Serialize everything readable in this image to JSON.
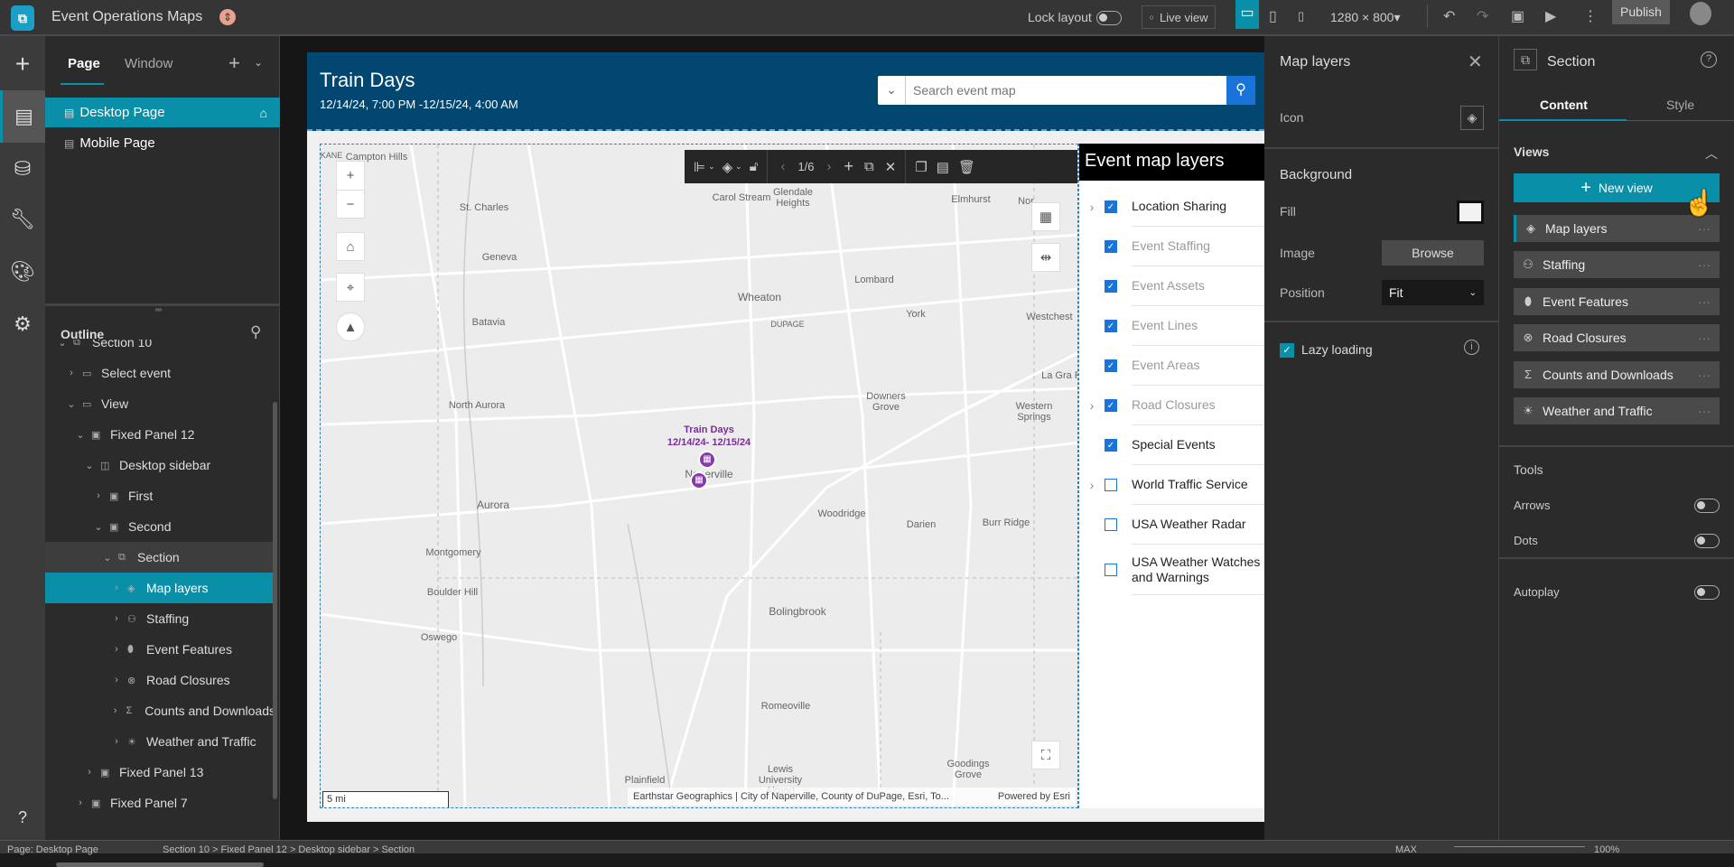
{
  "app": {
    "title": "Event Operations Maps",
    "status_color": "#e8a08f"
  },
  "topbar": {
    "lock_layout": "Lock layout",
    "lock_layout_on": false,
    "live_view": "Live view",
    "resolution": "1280 × 800",
    "publish": "Publish",
    "accent": "#0a8fa8"
  },
  "left": {
    "tabs": [
      "Page",
      "Window"
    ],
    "active_tab": "Page",
    "pages": [
      {
        "label": "Desktop Page",
        "home": true,
        "selected": true
      },
      {
        "label": "Mobile Page"
      }
    ],
    "outline_title": "Outline",
    "outline": [
      {
        "label": "Section 10",
        "depth": 0,
        "exp": "v",
        "icon": "section"
      },
      {
        "label": "Select event",
        "depth": 1,
        "exp": ">",
        "icon": "view"
      },
      {
        "label": "View",
        "depth": 1,
        "exp": "v",
        "icon": "view"
      },
      {
        "label": "Fixed Panel 12",
        "depth": 2,
        "exp": "v",
        "icon": "panel"
      },
      {
        "label": "Desktop sidebar",
        "depth": 3,
        "exp": "v",
        "icon": "sidebar"
      },
      {
        "label": "First",
        "depth": 4,
        "exp": ">",
        "icon": "panel"
      },
      {
        "label": "Second",
        "depth": 4,
        "exp": "v",
        "icon": "panel"
      },
      {
        "label": "Section",
        "depth": 5,
        "exp": "v",
        "icon": "section",
        "hover": true
      },
      {
        "label": "Map layers",
        "depth": 6,
        "exp": ">",
        "icon": "layers",
        "selected": true
      },
      {
        "label": "Staffing",
        "depth": 6,
        "exp": ">",
        "icon": "user"
      },
      {
        "label": "Event Features",
        "depth": 6,
        "exp": ">",
        "icon": "pin"
      },
      {
        "label": "Road Closures",
        "depth": 6,
        "exp": ">",
        "icon": "x-circle"
      },
      {
        "label": "Counts and Downloads",
        "depth": 6,
        "exp": ">",
        "icon": "sigma"
      },
      {
        "label": "Weather and Traffic",
        "depth": 6,
        "exp": ">",
        "icon": "weather"
      },
      {
        "label": "Fixed Panel 13",
        "depth": 3,
        "exp": ">",
        "icon": "panel"
      },
      {
        "label": "Fixed Panel 7",
        "depth": 2,
        "exp": ">",
        "icon": "panel"
      }
    ]
  },
  "page": {
    "title": "Train Days",
    "subtitle": "12/14/24, 7:00 PM -12/15/24, 4:00 AM",
    "header_color": "#02476f",
    "search_placeholder": "Search event map",
    "toolbar_pager": "1/6",
    "map": {
      "places": [
        "Campton Hills",
        "St. Charles",
        "Carol Stream",
        "Glendale Heights",
        "Elmhurst",
        "Geneva",
        "Wheaton",
        "Lombard",
        "DUPAGE",
        "York",
        "Batavia",
        "Westchest",
        "La Gra Par",
        "North Aurora",
        "Downers Grove",
        "Western Springs",
        "Naperville",
        "Aurora",
        "Woodridge",
        "Darien",
        "Burr Ridge",
        "Montgomery",
        "Boulder Hill",
        "Oswego",
        "Bolingbrook",
        "Romeoville",
        "Plainfield",
        "Lewis University Airport",
        "Goodings Grove",
        "Nor",
        "KANE"
      ],
      "event_label": "Train Days",
      "event_dates": "12/14/24- 12/15/24",
      "scale": "5 mi",
      "attribution": "Earthstar Geographics | City of Naperville, County of DuPage, Esri, To...",
      "powered": "Powered by Esri"
    },
    "layers_title": "Event map layers",
    "layers": [
      {
        "label": "Location Sharing",
        "checked": true,
        "expandable": true,
        "dim": false
      },
      {
        "label": "Event Staffing",
        "checked": true,
        "dim": true
      },
      {
        "label": "Event Assets",
        "checked": true,
        "dim": true
      },
      {
        "label": "Event Lines",
        "checked": true,
        "dim": true
      },
      {
        "label": "Event Areas",
        "checked": true,
        "dim": true
      },
      {
        "label": "Road Closures",
        "checked": true,
        "expandable": true,
        "dim": true
      },
      {
        "label": "Special Events",
        "checked": true,
        "dim": false
      },
      {
        "label": "World Traffic Service",
        "checked": false,
        "expandable": true,
        "dim": false
      },
      {
        "label": "USA Weather Radar",
        "checked": false,
        "dim": false
      },
      {
        "label": "USA Weather Watches and Warnings",
        "checked": false,
        "dim": false
      }
    ]
  },
  "settings": {
    "title": "Map layers",
    "icon_label": "Icon",
    "background": "Background",
    "fill": "Fill",
    "fill_color": "#f2f2f2",
    "image": "Image",
    "browse": "Browse",
    "position": "Position",
    "position_value": "Fit",
    "lazy_loading": "Lazy loading",
    "lazy_loading_on": true
  },
  "right": {
    "title": "Section",
    "tabs": [
      "Content",
      "Style"
    ],
    "active_tab": "Content",
    "views_title": "Views",
    "new_view": "New view",
    "views": [
      {
        "label": "Map layers",
        "icon": "layers",
        "active": true
      },
      {
        "label": "Staffing",
        "icon": "user"
      },
      {
        "label": "Event Features",
        "icon": "pin"
      },
      {
        "label": "Road Closures",
        "icon": "x-circle"
      },
      {
        "label": "Counts and Downloads",
        "icon": "sigma"
      },
      {
        "label": "Weather and Traffic",
        "icon": "weather"
      }
    ],
    "tools_title": "Tools",
    "arrows": "Arrows",
    "dots": "Dots",
    "autoplay": "Autoplay"
  },
  "statusbar": {
    "page": "Page: Desktop Page",
    "breadcrumb": "Section 10 > Fixed Panel 12 > Desktop sidebar > Section",
    "max": "MAX",
    "zoom": "100%"
  }
}
